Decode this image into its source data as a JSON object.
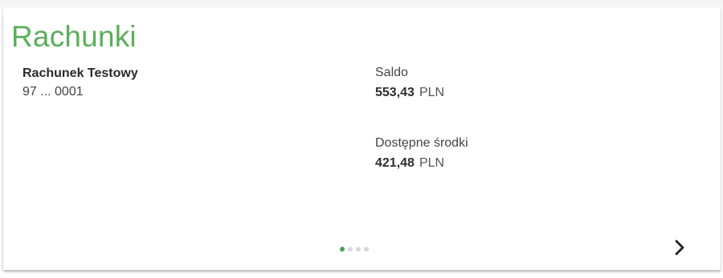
{
  "widget": {
    "title": "Rachunki",
    "account": {
      "name": "Rachunek Testowy",
      "number": "97 ... 0001"
    },
    "balance": {
      "label": "Saldo",
      "amount": "553,43",
      "currency": "PLN"
    },
    "available": {
      "label": "Dostępne środki",
      "amount": "421,48",
      "currency": "PLN"
    },
    "pagination": {
      "total": 4,
      "active_index": 0
    },
    "colors": {
      "title": "#5cae5a",
      "active_dot": "#4e9f4c",
      "inactive_dot": "#d7d7d7"
    },
    "icons": {
      "next": "chevron-right-icon"
    }
  }
}
